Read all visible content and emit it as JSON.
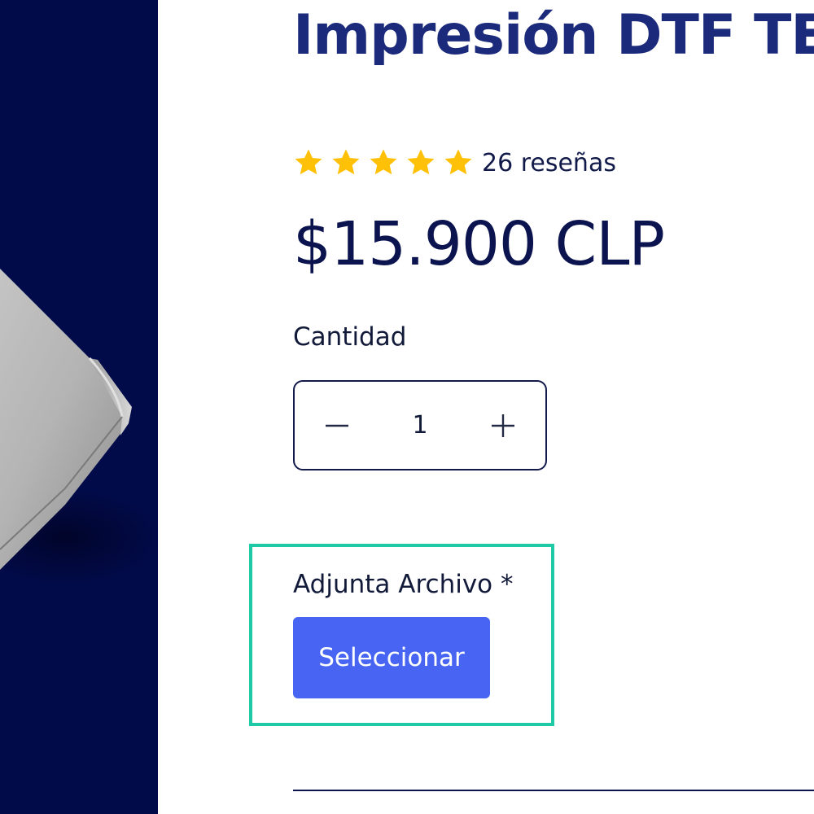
{
  "product": {
    "title": "Impresión DTF TE",
    "rating": {
      "stars": 5,
      "reviews_label": "26 reseñas"
    },
    "price": "$15.900 CLP"
  },
  "quantity": {
    "label": "Cantidad",
    "value": "1",
    "decrement_icon": "minus-icon",
    "increment_icon": "plus-icon"
  },
  "attachment": {
    "label": "Adjunta Archivo *",
    "button_label": "Seleccionar"
  },
  "colors": {
    "title": "#1b2a7a",
    "price": "#0c1450",
    "star": "#ffc107",
    "panel": "#020b4a",
    "highlight": "#1ec9a6",
    "button": "#4765f2"
  }
}
